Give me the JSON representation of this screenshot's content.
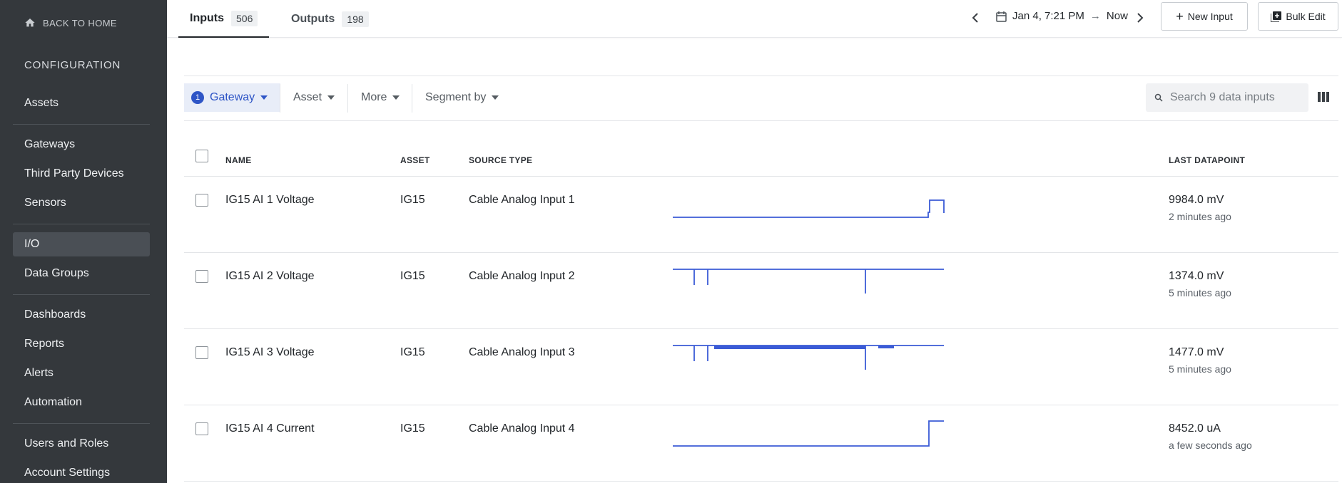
{
  "colors": {
    "accent": "#2e55c6",
    "sidebar_bg": "#34383c",
    "sparkline": "#3b5bd6"
  },
  "sidebar": {
    "back_label": "BACK TO HOME",
    "section_title": "CONFIGURATION",
    "items": [
      {
        "label": "Assets"
      },
      {
        "label": "Gateways"
      },
      {
        "label": "Third Party Devices"
      },
      {
        "label": "Sensors"
      },
      {
        "label": "I/O",
        "active": true
      },
      {
        "label": "Data Groups"
      },
      {
        "label": "Dashboards"
      },
      {
        "label": "Reports"
      },
      {
        "label": "Alerts"
      },
      {
        "label": "Automation"
      },
      {
        "label": "Users and Roles"
      },
      {
        "label": "Account Settings"
      }
    ]
  },
  "header": {
    "tabs": [
      {
        "label": "Inputs",
        "count": "506"
      },
      {
        "label": "Outputs",
        "count": "198"
      }
    ],
    "date_start": "Jan 4, 7:21 PM",
    "date_end": "Now",
    "new_input_label": "New Input",
    "bulk_edit_label": "Bulk Edit"
  },
  "filters": {
    "gateway": {
      "label": "Gateway",
      "count": "1"
    },
    "asset": {
      "label": "Asset"
    },
    "more": {
      "label": "More"
    },
    "segment": {
      "label": "Segment by"
    },
    "search_placeholder": "Search 9 data inputs"
  },
  "table": {
    "columns": {
      "name": "NAME",
      "asset": "ASSET",
      "source": "SOURCE TYPE",
      "last": "LAST DATAPOINT"
    },
    "rows": [
      {
        "name": "IG15 AI 1 Voltage",
        "asset": "IG15",
        "source": "Cable Analog Input 1",
        "value": "9984.0 mV",
        "time": "2 minutes ago"
      },
      {
        "name": "IG15 AI 2 Voltage",
        "asset": "IG15",
        "source": "Cable Analog Input 2",
        "value": "1374.0 mV",
        "time": "5 minutes ago"
      },
      {
        "name": "IG15 AI 3 Voltage",
        "asset": "IG15",
        "source": "Cable Analog Input 3",
        "value": "1477.0 mV",
        "time": "5 minutes ago"
      },
      {
        "name": "IG15 AI 4 Current",
        "asset": "IG15",
        "source": "Cable Analog Input 4",
        "value": "8452.0 uA",
        "time": "a few seconds ago"
      }
    ]
  }
}
